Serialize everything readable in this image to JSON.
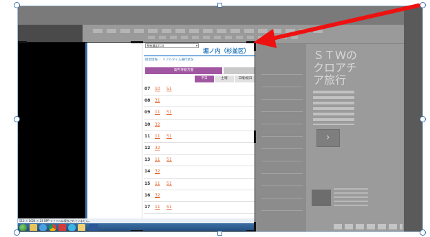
{
  "timetable": {
    "route_select": "系統選定(13)",
    "stop_name": "堀ノ内（杉並区）",
    "realtime_link": "接近情報 ｜ リアルタイム運行状況",
    "direction_tab": "高円寺駅方面",
    "day_tabs": {
      "weekday": "平日",
      "saturday": "土曜",
      "holiday": "日曜/祝日"
    },
    "rows": [
      {
        "hour": "07",
        "minutes": [
          "10",
          "51"
        ]
      },
      {
        "hour": "08",
        "minutes": [
          "31"
        ]
      },
      {
        "hour": "09",
        "minutes": [
          "11",
          "51"
        ]
      },
      {
        "hour": "10",
        "minutes": [
          "32"
        ]
      },
      {
        "hour": "11",
        "minutes": [
          "11",
          "51"
        ]
      },
      {
        "hour": "12",
        "minutes": [
          "32"
        ]
      },
      {
        "hour": "13",
        "minutes": [
          "11",
          "51"
        ]
      },
      {
        "hour": "14",
        "minutes": [
          "32"
        ]
      },
      {
        "hour": "15",
        "minutes": [
          "11",
          "51"
        ]
      },
      {
        "hour": "16",
        "minutes": [
          "32"
        ]
      },
      {
        "hour": "17",
        "minutes": [
          "11",
          "51"
        ]
      }
    ]
  },
  "background_page": {
    "sidebar_heading": "ＳＴＷの\nクロアチ\nア旅行"
  },
  "status_bar": {
    "text": "512 × 1024 × 24 BPP   ファイルは保存されていません。"
  },
  "colors": {
    "accent_purple": "#a056a0",
    "link_blue": "#2d7dbd",
    "minute_orange": "#e0602a",
    "arrow_red": "#ee1111",
    "handle_blue": "#3a6ea5"
  }
}
